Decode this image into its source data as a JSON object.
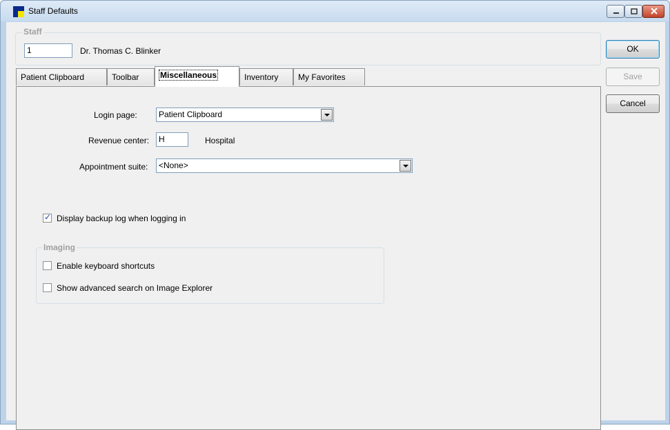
{
  "window": {
    "title": "Staff Defaults"
  },
  "staff": {
    "legend": "Staff",
    "id_value": "1",
    "name": "Dr. Thomas C. Blinker"
  },
  "buttons": {
    "ok": "OK",
    "save": "Save",
    "cancel": "Cancel"
  },
  "tabs": [
    {
      "label": "Patient Clipboard",
      "active": false
    },
    {
      "label": "Toolbar",
      "active": false
    },
    {
      "label": "Miscellaneous",
      "active": true
    },
    {
      "label": "Inventory",
      "active": false
    },
    {
      "label": "My Favorites",
      "active": false
    }
  ],
  "misc": {
    "login_page_label": "Login page:",
    "login_page_value": "Patient Clipboard",
    "revenue_center_label": "Revenue center:",
    "revenue_center_value": "H",
    "revenue_center_name": "Hospital",
    "appointment_suite_label": "Appointment suite:",
    "appointment_suite_value": "<None>",
    "display_backup_log": {
      "label": "Display backup log when logging in",
      "checked": true
    },
    "imaging": {
      "legend": "Imaging",
      "enable_keyboard_shortcuts": {
        "label": "Enable keyboard shortcuts",
        "checked": false
      },
      "show_advanced_search": {
        "label": "Show advanced search on Image Explorer",
        "checked": false
      }
    }
  },
  "colors": {
    "window_frame": "#bcd3ea",
    "client_bg": "#f0f0f0",
    "close_button": "#c2432a",
    "checkbox_check": "#1f4fa0"
  }
}
